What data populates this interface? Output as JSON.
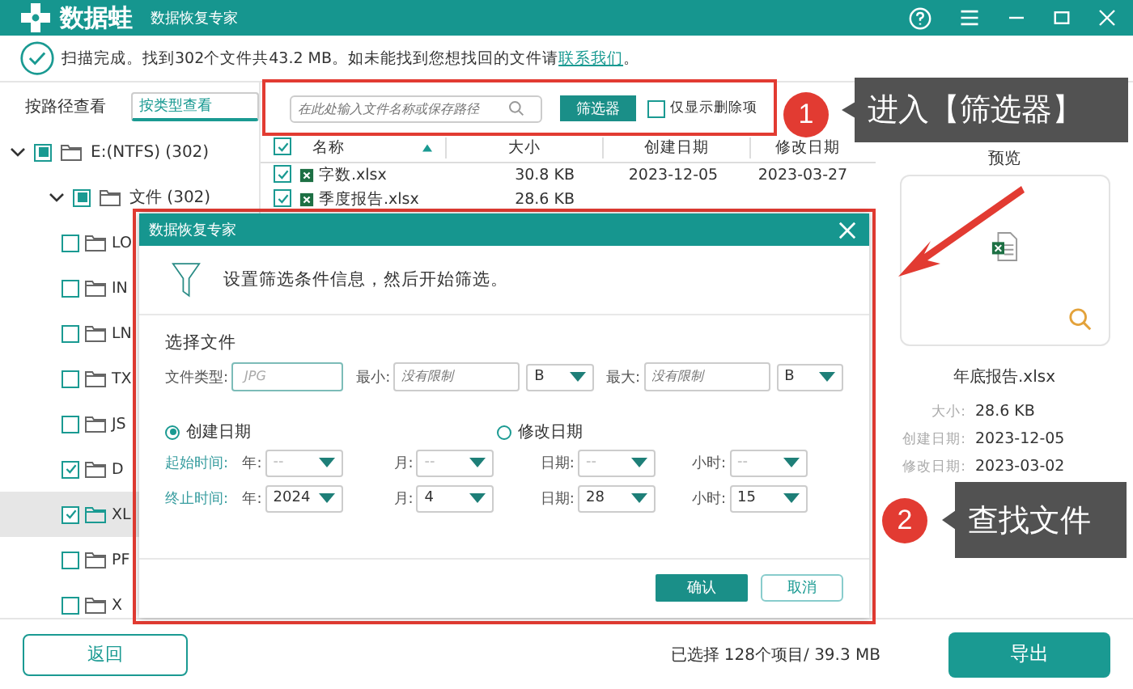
{
  "app": {
    "logo": "数据蛙",
    "title": "数据恢复专家"
  },
  "scan_status": {
    "text": "扫描完成。找到302个文件共43.2 MB。如未能找到您想找回的文件请",
    "link": "联系我们",
    "end": "。"
  },
  "view_tabs": [
    {
      "label": "按路径查看",
      "selected": false
    },
    {
      "label": "按类型查看",
      "selected": true
    }
  ],
  "tree": [
    {
      "label": "E:(NTFS) (302)",
      "expanded": true,
      "checked": false,
      "partial": true,
      "selected": false,
      "children": [
        {
          "label": "文件 (302)",
          "expanded": true,
          "checked": false,
          "partial": true,
          "selected": false,
          "children": [
            {
              "label": "LO",
              "checked": false,
              "partial": false,
              "selected": false
            },
            {
              "label": "IN",
              "checked": false,
              "partial": false,
              "selected": false
            },
            {
              "label": "LN",
              "checked": false,
              "partial": false,
              "selected": false
            },
            {
              "label": "TX",
              "checked": false,
              "partial": false,
              "selected": false
            },
            {
              "label": "JS",
              "checked": false,
              "partial": false,
              "selected": false
            },
            {
              "label": "D",
              "checked": true,
              "partial": false,
              "selected": false
            },
            {
              "label": "XL",
              "checked": true,
              "partial": false,
              "selected": true
            },
            {
              "label": "PF",
              "checked": false,
              "partial": false,
              "selected": false
            },
            {
              "label": "X",
              "checked": false,
              "partial": false,
              "selected": false
            }
          ]
        }
      ]
    }
  ],
  "search": {
    "placeholder": "在此处输入文件名称或保存路径"
  },
  "filter_button": "筛选器",
  "deleted_only": {
    "label": "仅显示删除项",
    "checked": false
  },
  "table": {
    "all_checked": true,
    "columns": [
      {
        "label": "名称",
        "sorted": true
      },
      {
        "label": "大小",
        "sorted": false
      },
      {
        "label": "创建日期",
        "sorted": false
      },
      {
        "label": "修改日期",
        "sorted": false
      }
    ],
    "rows": [
      {
        "checked": true,
        "cells": [
          "字数.xlsx",
          "30.8 KB",
          "2023-12-05",
          "2023-03-27"
        ]
      },
      {
        "checked": true,
        "cells": [
          "季度报告.xlsx",
          "28.6 KB"
        ]
      }
    ]
  },
  "preview": {
    "title": "预览",
    "file_name": "年底报告.xlsx",
    "details": [
      {
        "label": "大小:",
        "value": "28.6 KB"
      },
      {
        "label": "创建日期:",
        "value": "2023-12-05"
      },
      {
        "label": "修改日期:",
        "value": "2023-03-02"
      }
    ]
  },
  "footer": {
    "back": "返回",
    "summary": "已选择 128个项目/ 39.3 MB",
    "export": "导出"
  },
  "dialog": {
    "title": "数据恢复专家",
    "message": "设置筛选条件信息，然后开始筛选。",
    "section": "选择文件",
    "file_type": {
      "label": "文件类型:",
      "placeholder": "JPG"
    },
    "sizes": [
      {
        "label": "最小:",
        "placeholder": "没有限制",
        "unit": "B"
      },
      {
        "label": "最大:",
        "placeholder": "没有限制",
        "unit": "B"
      }
    ],
    "date_modes": [
      {
        "label": "创建日期",
        "selected": true
      },
      {
        "label": "修改日期",
        "selected": false
      }
    ],
    "time_rows": [
      {
        "label": "起始时间:",
        "fields": [
          {
            "label": "年:",
            "placeholder": "--"
          },
          {
            "label": "月:",
            "placeholder": "--"
          },
          {
            "label": "日期:",
            "placeholder": "--"
          },
          {
            "label": "小时:",
            "placeholder": "--"
          }
        ]
      },
      {
        "label": "终止时间:",
        "fields": [
          {
            "label": "年:",
            "value": "2024"
          },
          {
            "label": "月:",
            "value": "4"
          },
          {
            "label": "日期:",
            "value": "28"
          },
          {
            "label": "小时:",
            "value": "15"
          }
        ]
      }
    ],
    "buttons": [
      {
        "label": "确认",
        "kind": "primary"
      },
      {
        "label": "取消",
        "kind": "secondary"
      }
    ]
  },
  "callouts": [
    {
      "number": "1",
      "text": "进入【筛选器】"
    },
    {
      "number": "2",
      "text": "查找文件"
    }
  ]
}
